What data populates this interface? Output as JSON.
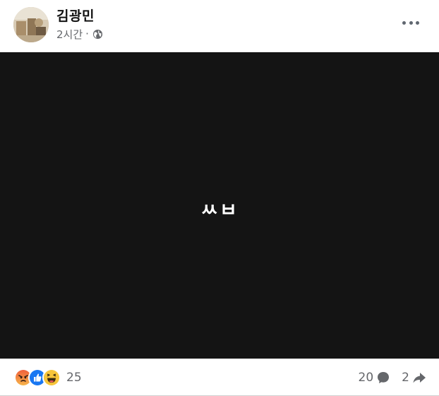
{
  "post": {
    "author": "김광민",
    "time": "2시간",
    "separator": "·",
    "privacy_icon": "globe-icon",
    "more_icon": "more-options-icon"
  },
  "media": {
    "text": "ㅆㅂ",
    "background": "#141414"
  },
  "footer": {
    "reaction_icons": [
      "angry-reaction-icon",
      "like-reaction-icon",
      "haha-reaction-icon"
    ],
    "reaction_count": "25",
    "comment_count": "20",
    "comment_icon": "comment-icon",
    "share_count": "2",
    "share_icon": "share-icon"
  },
  "colors": {
    "like_blue": "#1877f2",
    "angry_orange": "#f0603c",
    "haha_yellow": "#f7c53a",
    "secondary_text": "#65676b"
  }
}
